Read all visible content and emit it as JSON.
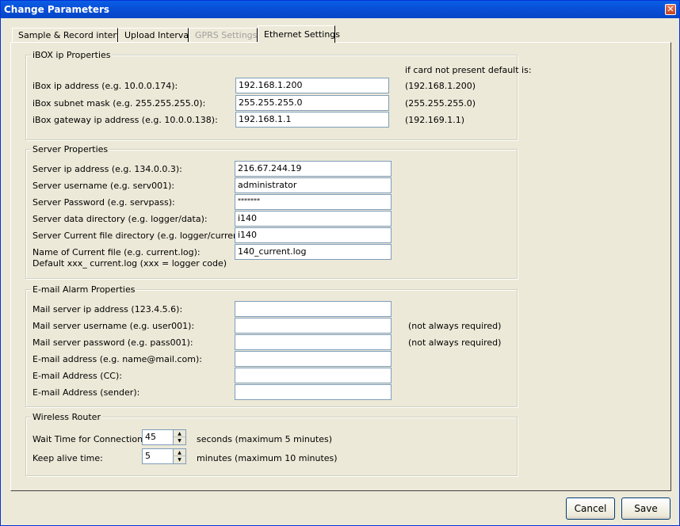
{
  "window": {
    "title": "Change Parameters"
  },
  "tabs": [
    {
      "label": "Sample & Record interval",
      "state": "normal"
    },
    {
      "label": "Upload Intervals",
      "state": "normal"
    },
    {
      "label": "GPRS Settings",
      "state": "disabled"
    },
    {
      "label": "Ethernet Settings",
      "state": "active"
    }
  ],
  "ibox": {
    "title": "iBOX ip Properties",
    "default_header": "if card not present default is:",
    "rows": [
      {
        "label": "iBox ip address (e.g. 10.0.0.174):",
        "value": "192.168.1.200",
        "default": "(192.168.1.200)"
      },
      {
        "label": "iBox subnet mask (e.g. 255.255.255.0):",
        "value": "255.255.255.0",
        "default": "(255.255.255.0)"
      },
      {
        "label": "iBox gateway ip address (e.g. 10.0.0.138):",
        "value": "192.168.1.1",
        "default": "(192.169.1.1)"
      }
    ]
  },
  "server": {
    "title": "Server Properties",
    "rows": [
      {
        "label": "Server ip address (e.g. 134.0.0.3):",
        "value": "216.67.244.19"
      },
      {
        "label": "Server username (e.g. serv001):",
        "value": "administrator"
      },
      {
        "label": "Server Password (e.g. servpass):",
        "value": "*******"
      },
      {
        "label": "Server data directory (e.g. logger/data):",
        "value": "i140"
      },
      {
        "label": "Server Current file directory (e.g. logger/current):",
        "value": "i140"
      },
      {
        "label": "Name of Current file (e.g. current.log):",
        "value": "140_current.log"
      }
    ],
    "note": "Default xxx_ current.log (xxx = logger code)"
  },
  "email": {
    "title": "E-mail Alarm Properties",
    "rows": [
      {
        "label": "Mail server ip address (123.4.5.6):",
        "value": "",
        "note": ""
      },
      {
        "label": "Mail server username (e.g. user001):",
        "value": "",
        "note": "(not always required)"
      },
      {
        "label": "Mail server password (e.g. pass001):",
        "value": "",
        "note": "(not always required)"
      },
      {
        "label": "E-mail address (e.g. name@mail.com):",
        "value": "",
        "note": ""
      },
      {
        "label": "E-mail Address (CC):",
        "value": "",
        "note": ""
      },
      {
        "label": "E-mail Address (sender):",
        "value": "",
        "note": ""
      }
    ]
  },
  "router": {
    "title": "Wireless Router",
    "wait_label": "Wait Time  for Connection:",
    "wait_value": "45",
    "wait_unit": "seconds (maximum 5 minutes)",
    "keep_label": "Keep alive time:",
    "keep_value": "5",
    "keep_unit": "minutes (maximum 10 minutes)"
  },
  "buttons": {
    "cancel": "Cancel",
    "save": "Save"
  },
  "icons": {
    "close": "close-icon",
    "spin_up": "spin-up-icon",
    "spin_down": "spin-down-icon"
  }
}
